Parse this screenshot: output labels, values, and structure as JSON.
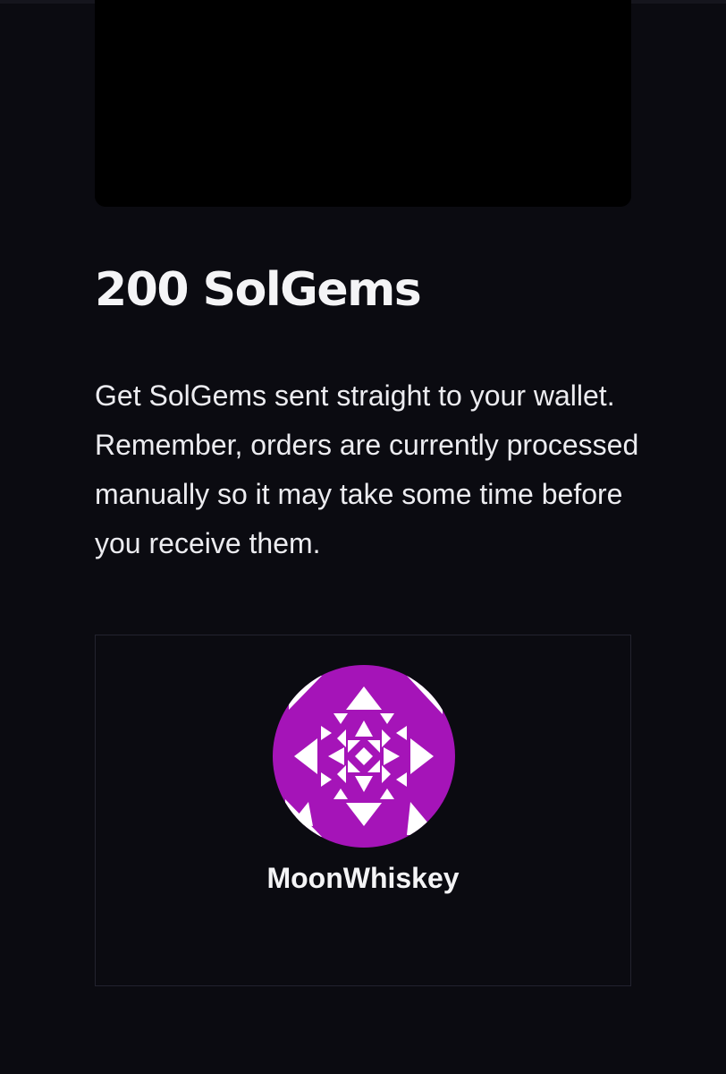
{
  "product": {
    "title": "200 SolGems",
    "description": "Get SolGems sent straight to your wallet. Remember, orders are currently processed manually so it may take some time before you receive them."
  },
  "seller": {
    "name": "MoonWhiskey",
    "avatar_icon": "identicon-avatar",
    "avatar_color": "#a514b8"
  },
  "colors": {
    "background": "#0b0b11",
    "media_box": "#000000",
    "card_border": "#23232f",
    "text": "#f4f4f6"
  }
}
